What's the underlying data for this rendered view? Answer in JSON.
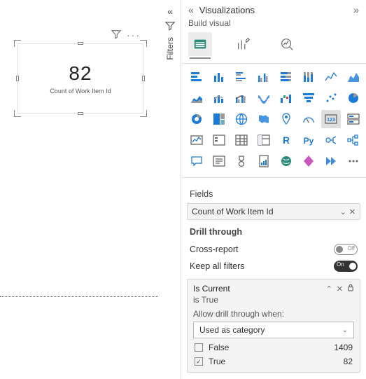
{
  "canvas": {
    "visual": {
      "value": "82",
      "caption": "Count of Work Item Id"
    }
  },
  "filters_tab": {
    "label": "Filters"
  },
  "pane": {
    "title": "Visualizations",
    "subtitle": "Build visual",
    "fields_label": "Fields",
    "field": {
      "name": "Count of Work Item Id"
    },
    "drill_label": "Drill through",
    "cross_report_label": "Cross-report",
    "cross_report_state": "Off",
    "keep_filters_label": "Keep all filters",
    "keep_filters_state": "On",
    "filter": {
      "title": "Is Current",
      "summary": "is True",
      "help": "Allow drill through when:",
      "select_value": "Used as category",
      "options": [
        {
          "label": "False",
          "count": "1409",
          "checked": false
        },
        {
          "label": "True",
          "count": "82",
          "checked": true
        }
      ]
    }
  }
}
